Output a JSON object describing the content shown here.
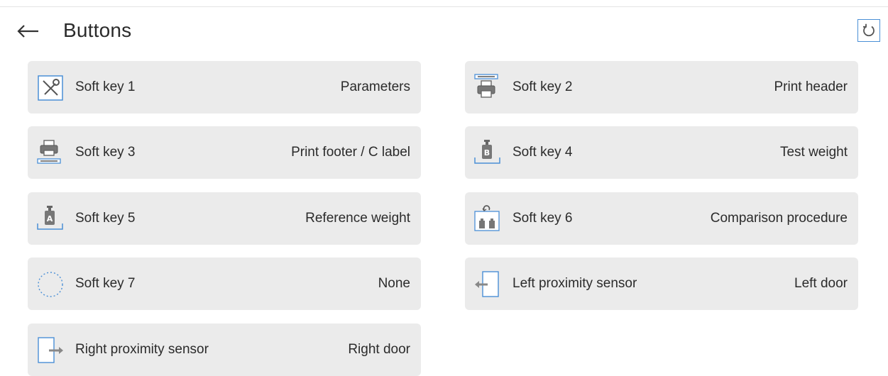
{
  "header": {
    "title": "Buttons",
    "back_icon": "arrow-left-icon",
    "reset_icon": "reset-icon"
  },
  "accent_color": "#4a8fd6",
  "tiles": [
    {
      "label": "Soft key 1",
      "value": "Parameters",
      "icon": "tools-icon"
    },
    {
      "label": "Soft key 2",
      "value": "Print header",
      "icon": "print-header-icon"
    },
    {
      "label": "Soft key 3",
      "value": "Print footer / C label",
      "icon": "print-footer-icon"
    },
    {
      "label": "Soft key 4",
      "value": "Test weight",
      "icon": "test-weight-icon"
    },
    {
      "label": "Soft key 5",
      "value": "Reference weight",
      "icon": "reference-weight-icon"
    },
    {
      "label": "Soft key 6",
      "value": "Comparison procedure",
      "icon": "comparison-icon"
    },
    {
      "label": "Soft key 7",
      "value": "None",
      "icon": "empty-circle-icon"
    },
    {
      "label": "Left proximity sensor",
      "value": "Left door",
      "icon": "left-door-icon"
    },
    {
      "label": "Right proximity sensor",
      "value": "Right door",
      "icon": "right-door-icon"
    }
  ]
}
